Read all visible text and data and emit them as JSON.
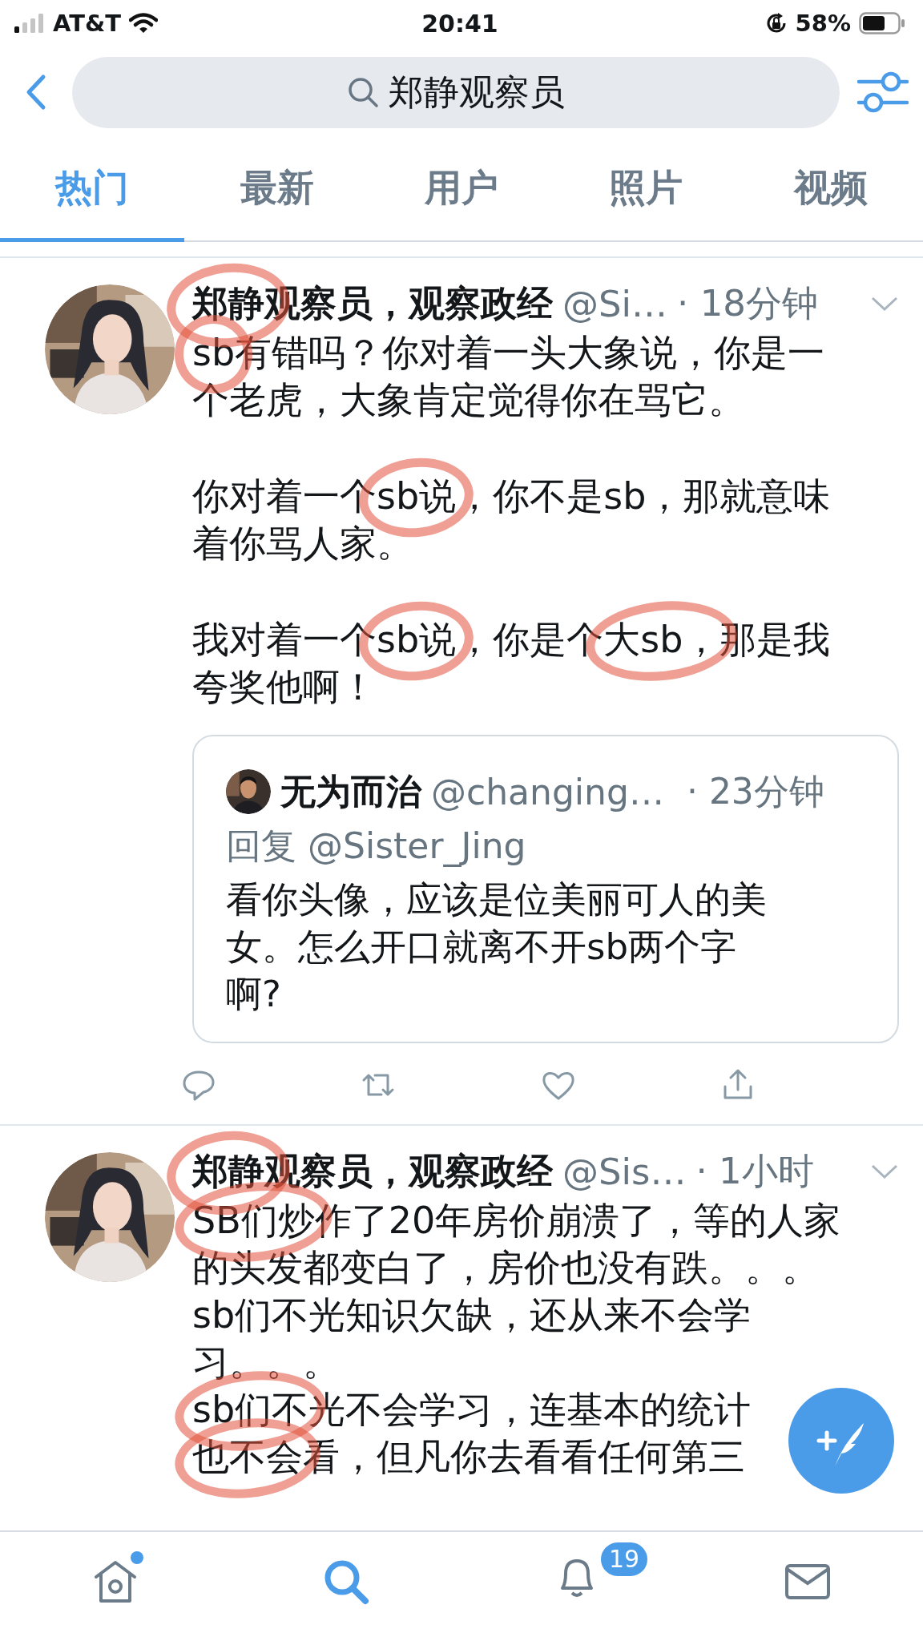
{
  "status_bar": {
    "carrier": "AT&T",
    "time": "20:41",
    "battery": "58%"
  },
  "search": {
    "value": "郑静观察员"
  },
  "tabs": [
    {
      "label": "热门",
      "selected": true
    },
    {
      "label": "最新",
      "selected": false
    },
    {
      "label": "用户",
      "selected": false
    },
    {
      "label": "照片",
      "selected": false
    },
    {
      "label": "视频",
      "selected": false
    }
  ],
  "tweets": [
    {
      "name": "郑静观察员，观察政经",
      "handle": "@Si…",
      "time": "· 18分钟",
      "name_circled": true,
      "paragraphs": [
        {
          "lines": [
            [
              {
                "text": "sb",
                "circled": true
              },
              {
                "text": "有错吗？你对着一头大象说，你是一",
                "circled": false
              }
            ],
            [
              {
                "text": "个老虎，大象肯定觉得你在骂它。",
                "circled": false
              }
            ]
          ]
        },
        {
          "lines": [
            [
              {
                "text": "你对着一个",
                "circled": false
              },
              {
                "text": "sb说",
                "circled": true
              },
              {
                "text": "，你不是sb，那就意味",
                "circled": false
              }
            ],
            [
              {
                "text": "着你骂人家。",
                "circled": false
              }
            ]
          ]
        },
        {
          "lines": [
            [
              {
                "text": "我对着一个",
                "circled": false
              },
              {
                "text": "sb说",
                "circled": true
              },
              {
                "text": "，你是个",
                "circled": false
              },
              {
                "text": "大sb，",
                "circled": true
              },
              {
                "text": "那是我",
                "circled": false
              }
            ],
            [
              {
                "text": "夸奖他啊！",
                "circled": false
              }
            ]
          ]
        }
      ],
      "quote": {
        "name": "无为而治",
        "handle": "@changing…",
        "time": "· 23分钟",
        "reply_to": "回复 @Sister_Jing",
        "lines": [
          "看你头像，应该是位美丽可人的美",
          "女。怎么开口就离不开sb两个字",
          "啊?"
        ]
      }
    },
    {
      "name": "郑静观察员，观察政经",
      "handle": "@Sis…",
      "time": "· 1小时",
      "name_circled": true,
      "paragraphs": [
        {
          "lines": [
            [
              {
                "text": "SB们炒",
                "circled": true
              },
              {
                "text": "作了20年房价崩溃了，等的人家",
                "circled": false
              }
            ],
            [
              {
                "text": "的头发都变白了，房价也没有跌。。。",
                "circled": false
              }
            ],
            [
              {
                "text": "sb们不光知识欠缺，还从来不会学",
                "circled": false
              }
            ],
            [
              {
                "text": "习。。。",
                "circled": false
              }
            ],
            [
              {
                "text": "sb们不",
                "circled": true
              },
              {
                "text": "光不会学习，连基本的统计",
                "circled": false
              }
            ],
            [
              {
                "text": "也不会",
                "circled": true
              },
              {
                "text": "看，但凡你去看看任何第三",
                "circled": false
              }
            ]
          ]
        }
      ]
    }
  ],
  "tab_bar": [
    {
      "kind": "home",
      "selected": false,
      "dot": true
    },
    {
      "kind": "search",
      "selected": true,
      "dot": false
    },
    {
      "kind": "notifications",
      "selected": false,
      "dot": false,
      "count": "19"
    },
    {
      "kind": "messages",
      "selected": false,
      "dot": false
    }
  ]
}
